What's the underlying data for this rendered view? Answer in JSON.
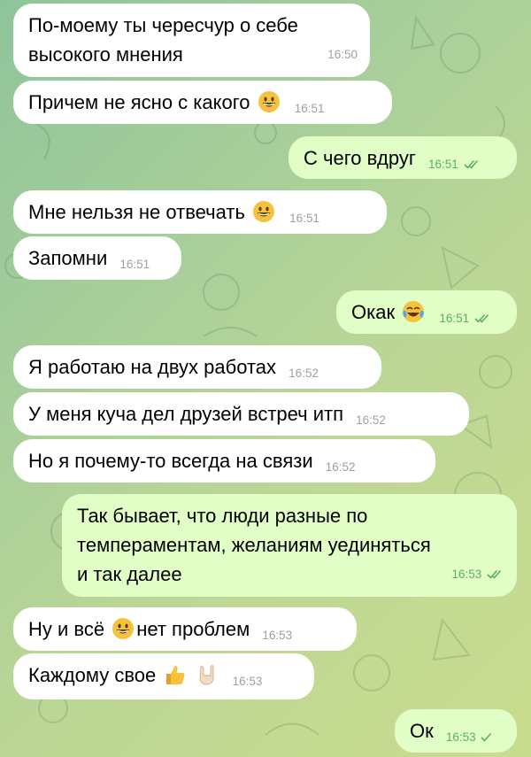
{
  "messages": [
    {
      "dir": "in",
      "text": "По-моему ты чересчур о себе\nвысокого мнения",
      "time": "16:50"
    },
    {
      "dir": "in",
      "text_before": "Причем не ясно с какого",
      "emoji_after": "grinning-face-icon",
      "time": "16:51"
    },
    {
      "dir": "out",
      "text": "С чего вдруг",
      "time": "16:51",
      "read": true
    },
    {
      "dir": "in",
      "text_before": "Мне  нельзя не отвечать",
      "emoji_after": "grinning-face-icon",
      "time": "16:51"
    },
    {
      "dir": "in",
      "text": "Запомни",
      "time": "16:51"
    },
    {
      "dir": "out",
      "text_before": "Окак",
      "emoji_after": "tears-of-joy-icon",
      "time": "16:51",
      "read": true
    },
    {
      "dir": "in",
      "text": "Я работаю на двух работах",
      "time": "16:52"
    },
    {
      "dir": "in",
      "text": "У меня куча дел друзей встреч итп",
      "time": "16:52"
    },
    {
      "dir": "in",
      "text": "Но я почему-то всегда на связи",
      "time": "16:52"
    },
    {
      "dir": "out",
      "text": "Так бывает, что люди разные по\nтемпераментам, желаниям уединяться\nи так далее",
      "time": "16:53",
      "read": true
    },
    {
      "dir": "in",
      "text_before": "Ну и всё",
      "emoji_mid": "grinning-face-icon",
      "text_after": "нет проблем",
      "time": "16:53"
    },
    {
      "dir": "in",
      "text_before": "Каждому свое",
      "emoji_after": "thumbs-up-icon, rock-hand-icon",
      "time": "16:53"
    },
    {
      "dir": "out",
      "text": "Ок",
      "time": "16:53",
      "read": false
    }
  ]
}
